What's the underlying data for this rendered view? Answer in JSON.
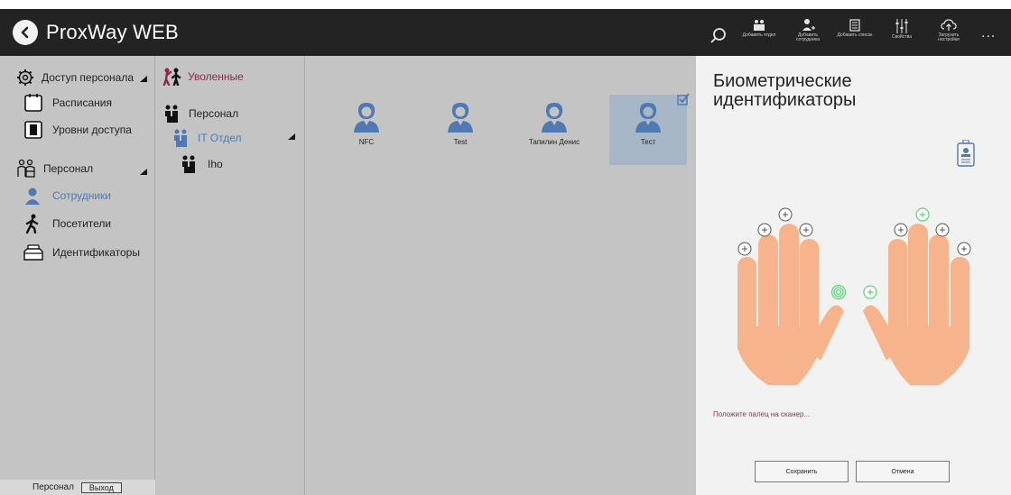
{
  "app": {
    "title": "ProxWay WEB"
  },
  "toolbar": {
    "add_dept": "Добавить отдел",
    "add_employee": "Добавить сотрудника",
    "add_list": "Добавить список",
    "properties": "Свойства",
    "upload_settings": "Загрузить настройки",
    "more": "..."
  },
  "sidebar": {
    "access": "Доступ персонала",
    "schedules": "Расписания",
    "access_levels": "Уровни доступа",
    "personnel": "Персонал",
    "employees": "Сотрудники",
    "visitors": "Посетители",
    "identifiers": "Идентификаторы",
    "active_color": "#4f79b0"
  },
  "tree": {
    "fired": "Уволенные",
    "personnel": "Персонал",
    "it_dept": "IT Отдел",
    "iho": "Iho"
  },
  "employees": [
    {
      "name": "NFC"
    },
    {
      "name": "Test"
    },
    {
      "name": "Тапилин Денис"
    },
    {
      "name": "Тест"
    }
  ],
  "bio": {
    "title": "Биометрические идентификаторы",
    "status": "Положите палец на сканер...",
    "save": "Сохранить",
    "cancel": "Отмена"
  },
  "footer": {
    "label": "Персонал",
    "exit": "Выход"
  },
  "colors": {
    "topbar": "#232323",
    "panel": "#c4c4c4",
    "selected_card": "#a8b7c8",
    "fired_text": "#8a2a4a",
    "hand": "#f7b48c",
    "scanned": "#5cd67a"
  }
}
